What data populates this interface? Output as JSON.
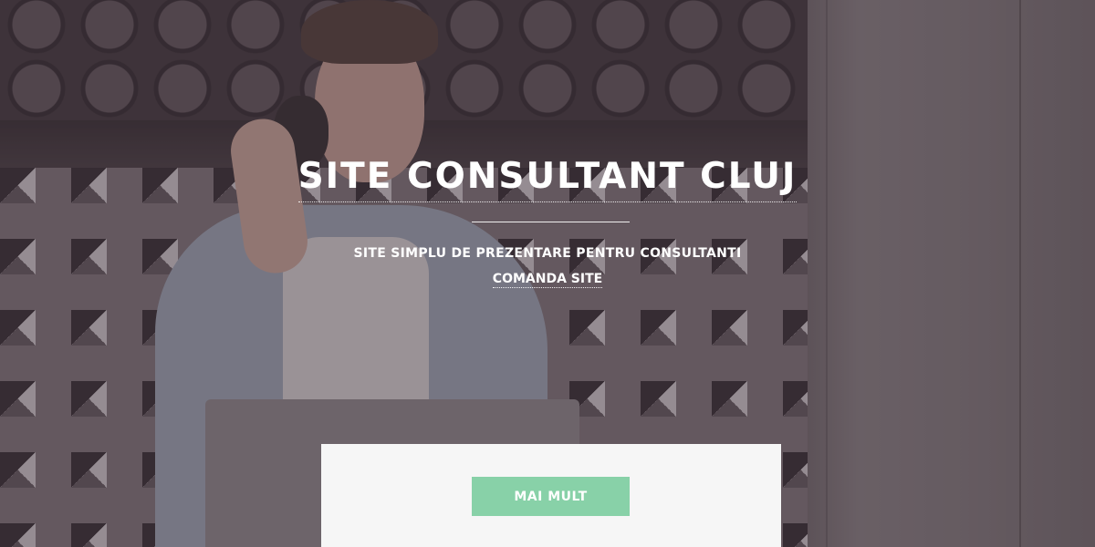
{
  "hero": {
    "title": "SITE CONSULTANT CLUJ",
    "subtitle": "SITE SIMPLU DE PREZENTARE PENTRU CONSULTANTI",
    "order_link": "COMANDA SITE",
    "more_button": "MAI MULT"
  },
  "colors": {
    "overlay": "#463a42",
    "button_bg": "#88d1a8",
    "panel_bg": "#f6f6f6",
    "text": "#ffffff"
  }
}
